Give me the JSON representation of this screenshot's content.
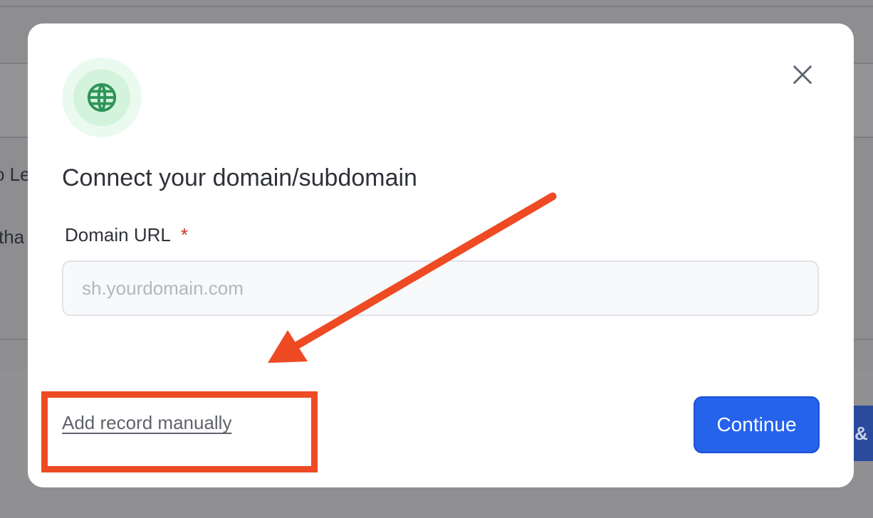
{
  "background": {
    "partial_text_1": "o Le",
    "partial_text_2": "tha",
    "partial_button_text": "&"
  },
  "modal": {
    "icon": "globe-icon",
    "close_icon": "close-icon",
    "title": "Connect your domain/subdomain",
    "field_label": "Domain URL",
    "required_marker": "*",
    "input_value": "",
    "input_placeholder": "sh.yourdomain.com",
    "manual_link": "Add record manually",
    "continue_label": "Continue"
  },
  "colors": {
    "accent": "#2563eb",
    "icon_green": "#2e9457",
    "annotation": "#ee4a23",
    "required": "#c0392b"
  }
}
